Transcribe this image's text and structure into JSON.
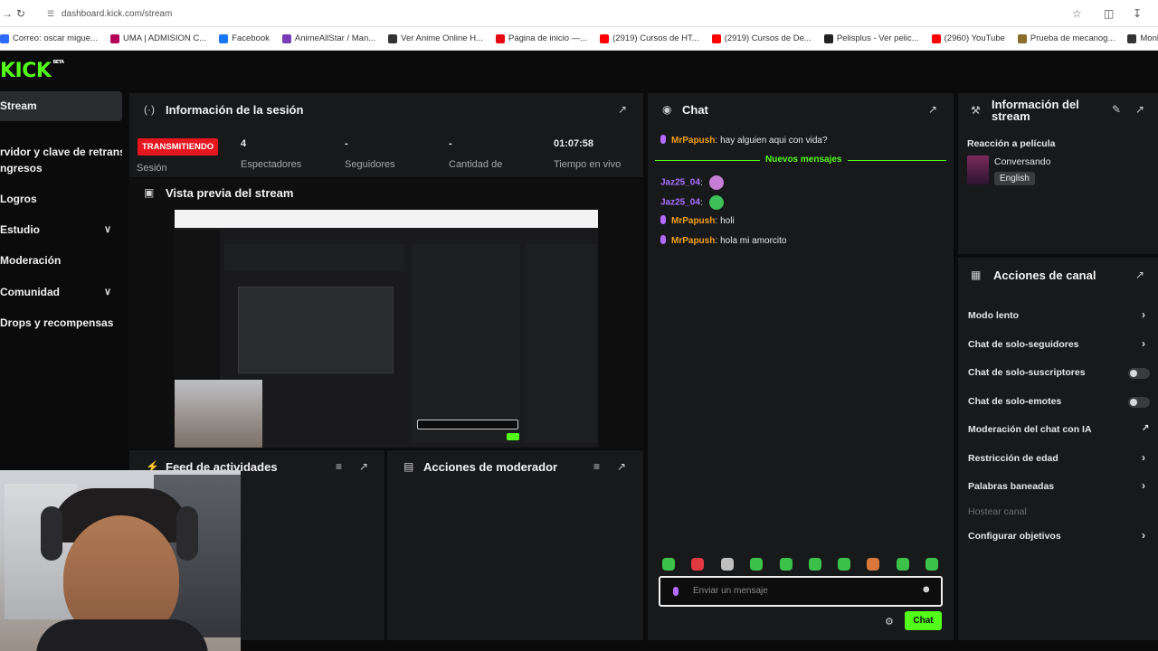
{
  "browser": {
    "url": "dashboard.kick.com/stream",
    "bookmarks": [
      {
        "label": "Correo: oscar migue...",
        "color": "#2b6cff"
      },
      {
        "label": "UMA | ADMISION C...",
        "color": "#b3005b"
      },
      {
        "label": "Facebook",
        "color": "#1877f2"
      },
      {
        "label": "AnimeAllStar / Man...",
        "color": "#7a3cb8"
      },
      {
        "label": "Ver Anime Online H...",
        "color": "#333333"
      },
      {
        "label": "Página de inicio —...",
        "color": "#e50914"
      },
      {
        "label": "(2919) Cursos de HT...",
        "color": "#ff0000"
      },
      {
        "label": "(2919) Cursos de De...",
        "color": "#ff0000"
      },
      {
        "label": "Pelisplus - Ver pelic...",
        "color": "#222222"
      },
      {
        "label": "(2960) YouTube",
        "color": "#ff0000"
      },
      {
        "label": "Prueba de mecanog...",
        "color": "#8a6d2b"
      },
      {
        "label": "Monkeytype | A min...",
        "color": "#333333"
      }
    ]
  },
  "app": {
    "logo_text": "KICK",
    "logo_sup": "BETA",
    "accent": "#53fc18"
  },
  "sidebar": {
    "items": [
      {
        "label": "Stream",
        "active": true,
        "chevron": false
      },
      {
        "label": "rvidor y clave de retransm",
        "active": false,
        "chevron": false
      },
      {
        "label": "ngresos",
        "active": false,
        "chevron": false
      },
      {
        "label": "Logros",
        "active": false,
        "chevron": false
      },
      {
        "label": "Estudio",
        "active": false,
        "chevron": true
      },
      {
        "label": "Moderación",
        "active": false,
        "chevron": false
      },
      {
        "label": "Comunidad",
        "active": false,
        "chevron": true
      },
      {
        "label": "Drops y recompensas",
        "active": false,
        "chevron": false
      }
    ]
  },
  "session": {
    "title": "Información de la sesión",
    "live_badge": "TRANSMITIENDO",
    "session_label": "Sesión",
    "stats": [
      {
        "value": "4",
        "label": "Espectadores"
      },
      {
        "value": "-",
        "label": "Seguidores"
      },
      {
        "value": "-",
        "label": "Cantidad de"
      },
      {
        "value": "01:07:58",
        "label": "Tiempo en vivo"
      }
    ]
  },
  "preview": {
    "title": "Vista previa del stream"
  },
  "feed": {
    "title": "Feed de actividades"
  },
  "mod_actions": {
    "title": "Acciones de moderador"
  },
  "chat": {
    "title": "Chat",
    "new_messages": "Nuevos mensajes",
    "messages": [
      {
        "user": "MrPapush",
        "text": "hay alguien aqui con vida?",
        "color": "orange",
        "mic": true
      },
      {
        "user": "Jaz25_04",
        "text": "",
        "color": "purple",
        "mic": false
      },
      {
        "user": "Jaz25_04",
        "text": "",
        "color": "purple",
        "mic": false
      },
      {
        "user": "MrPapush",
        "text": "holi",
        "color": "orange",
        "mic": true
      },
      {
        "user": "MrPapush",
        "text": "hola mi amorcito",
        "color": "orange",
        "mic": true
      }
    ],
    "input_placeholder": "Enviar un mensaje",
    "send_label": "Chat",
    "sep": ":"
  },
  "stream_info": {
    "title_line1": "Información del",
    "title_line2": "stream",
    "category_label": "Reacción a película",
    "status": "Conversando",
    "language": "English"
  },
  "channel_actions": {
    "title": "Acciones de canal",
    "items": [
      {
        "label": "Modo lento",
        "control": "chevron"
      },
      {
        "label": "Chat de solo-seguidores",
        "control": "chevron"
      },
      {
        "label": "Chat de solo-suscriptores",
        "control": "toggle"
      },
      {
        "label": "Chat de solo-emotes",
        "control": "toggle"
      },
      {
        "label": "Moderación del chat con IA",
        "control": "external"
      },
      {
        "label": "Restricción de edad",
        "control": "chevron"
      },
      {
        "label": "Palabras baneadas",
        "control": "chevron"
      },
      {
        "label": "Hostear canal",
        "control": "none",
        "disabled": true
      },
      {
        "label": "Configurar objetivos",
        "control": "chevron"
      }
    ]
  }
}
